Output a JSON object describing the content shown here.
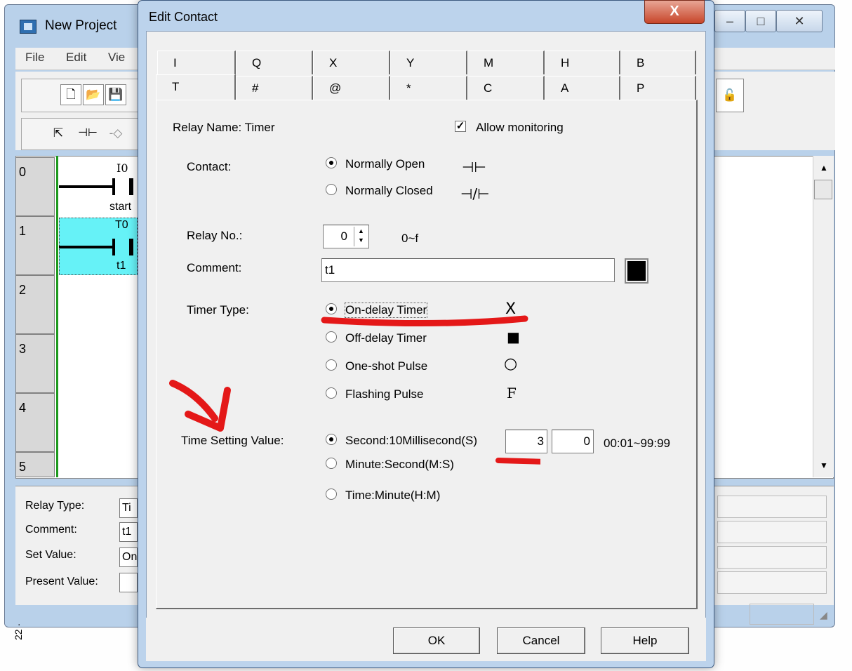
{
  "bg_window": {
    "title": "New Project",
    "menu": [
      "File",
      "Edit",
      "Vie"
    ],
    "controls": [
      "–",
      "□",
      "✕"
    ],
    "ladder": {
      "rungs": [
        "0",
        "1",
        "2",
        "3",
        "4",
        "5"
      ],
      "contact0_top": "I0",
      "contact0_bottom": "start",
      "contact1_top": "T0",
      "contact1_bottom": "t1"
    },
    "status": {
      "relay_type_label": "Relay Type:",
      "relay_type_value": "Ti",
      "comment_label": "Comment:",
      "comment_value": "t1",
      "set_value_label": "Set Value:",
      "set_value_value": "On",
      "present_value_label": "Present Value:",
      "present_value_value": ""
    },
    "side_text": "22 ·"
  },
  "dialog": {
    "title": "Edit Contact",
    "close_label": "X",
    "tabs_row1": [
      "I",
      "Q",
      "X",
      "Y",
      "M",
      "H",
      "B"
    ],
    "tabs_row2": [
      "T",
      "#",
      "@",
      "*",
      "C",
      "A",
      "P"
    ],
    "relay_name": "Relay Name:  Timer",
    "allow_monitoring": {
      "label": "Allow monitoring",
      "checked": true
    },
    "contact": {
      "label": "Contact:",
      "options": [
        {
          "label": "Normally Open",
          "symbol": "⊣⊢",
          "selected": true
        },
        {
          "label": "Normally Closed",
          "symbol": "⊣/⊢",
          "selected": false
        }
      ]
    },
    "relay_no": {
      "label": "Relay No.:",
      "value": "0",
      "range": "0~f"
    },
    "comment": {
      "label": "Comment:",
      "value": "t1"
    },
    "timer_type": {
      "label": "Timer Type:",
      "options": [
        {
          "label": "On-delay Timer",
          "symbol": "X",
          "selected": true
        },
        {
          "label": "Off-delay Timer",
          "symbol": "■",
          "selected": false
        },
        {
          "label": "One-shot Pulse",
          "symbol": "○",
          "selected": false
        },
        {
          "label": "Flashing Pulse",
          "symbol": "F",
          "selected": false
        }
      ]
    },
    "time_setting": {
      "label": "Time Setting Value:",
      "options": [
        {
          "label": "Second:10Millisecond(S)",
          "selected": true
        },
        {
          "label": "Minute:Second(M:S)",
          "selected": false
        },
        {
          "label": "Time:Minute(H:M)",
          "selected": false
        }
      ],
      "value1": "3",
      "value2": "0",
      "range": "00:01~99:99"
    },
    "buttons": {
      "ok": "OK",
      "cancel": "Cancel",
      "help": "Help"
    }
  },
  "annotation_color": "#e41818"
}
